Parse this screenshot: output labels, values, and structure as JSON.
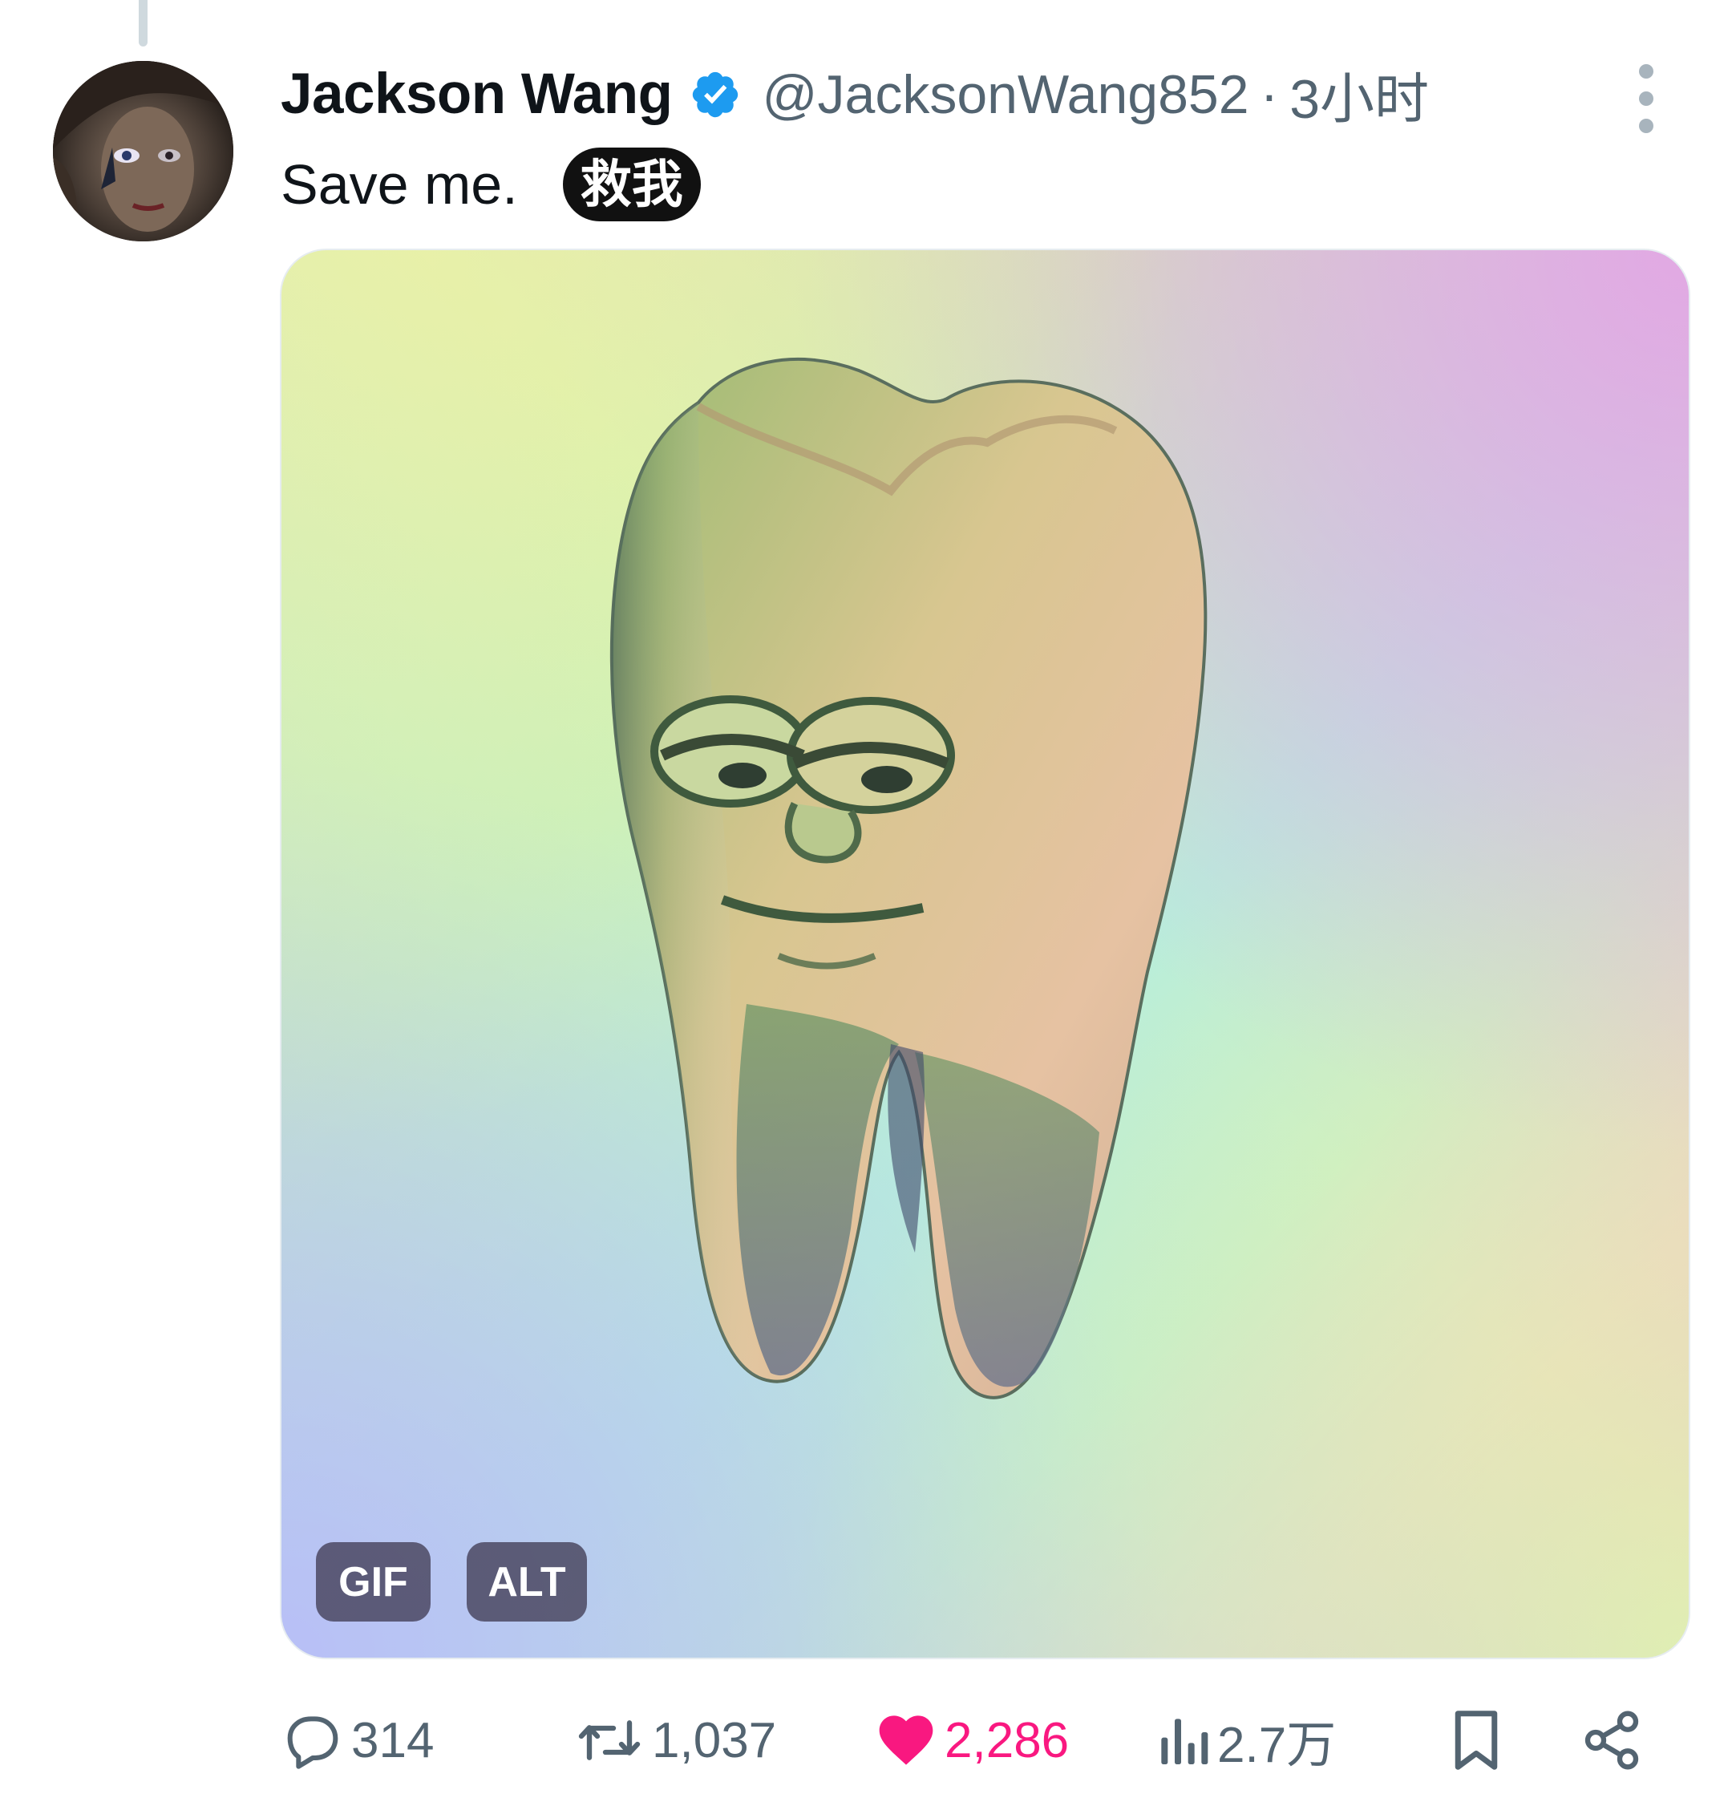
{
  "tweet": {
    "display_name": "Jackson Wang",
    "handle": "@JacksonWang852",
    "separator": "·",
    "time": "3小时",
    "text": "Save me.",
    "subtitle": "救我",
    "media": {
      "badges": [
        "GIF",
        "ALT"
      ]
    },
    "actions": {
      "replies": "314",
      "retweets": "1,037",
      "likes": "2,286",
      "views": "2.7万"
    }
  },
  "colors": {
    "verified_blue": "#1d9bf0",
    "like_pink": "#f91880",
    "secondary_text": "#536471"
  },
  "icons": [
    "verified-badge-icon",
    "more-options-icon",
    "reply-icon",
    "retweet-icon",
    "like-heart-icon",
    "views-icon",
    "bookmark-icon",
    "share-icon"
  ]
}
